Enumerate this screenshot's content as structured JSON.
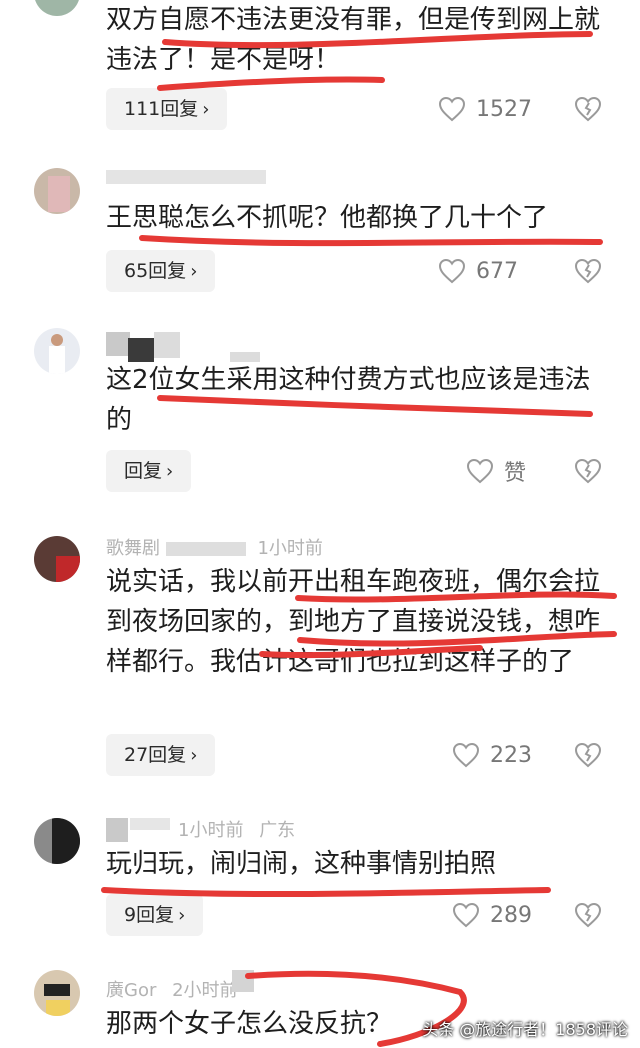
{
  "comments": [
    {
      "text": "双方自愿不违法更没有罪，但是传到网上就违法了！是不是呀！",
      "reply": "111回复",
      "likes": "1527"
    },
    {
      "text": "王思聪怎么不抓呢？他都换了几十个了",
      "reply": "65回复",
      "likes": "677"
    },
    {
      "text": "这2位女生采用这种付费方式也应该是违法的",
      "reply": "回复",
      "likes": "赞"
    },
    {
      "username": "歌舞剧",
      "time": "1小时前",
      "text": "说实话，我以前开出租车跑夜班，偶尔会拉到夜场回家的，到地方了直接说没钱，想咋样都行。我估计这哥们也拉到这样子的了",
      "reply": "27回复",
      "likes": "223"
    },
    {
      "time": "1小时前",
      "location": "广东",
      "text": "玩归玩，闹归闹，这种事情别拍照",
      "reply": "9回复",
      "likes": "289"
    },
    {
      "username": "廣Gor",
      "time": "2小时前",
      "text": "那两个女子怎么没反抗？"
    }
  ],
  "watermark": "头条 @旅途行者！1858评论",
  "colors": {
    "underline": "#e53935",
    "reply_bg": "#f2f2f2",
    "icon": "#9a9a9a"
  }
}
